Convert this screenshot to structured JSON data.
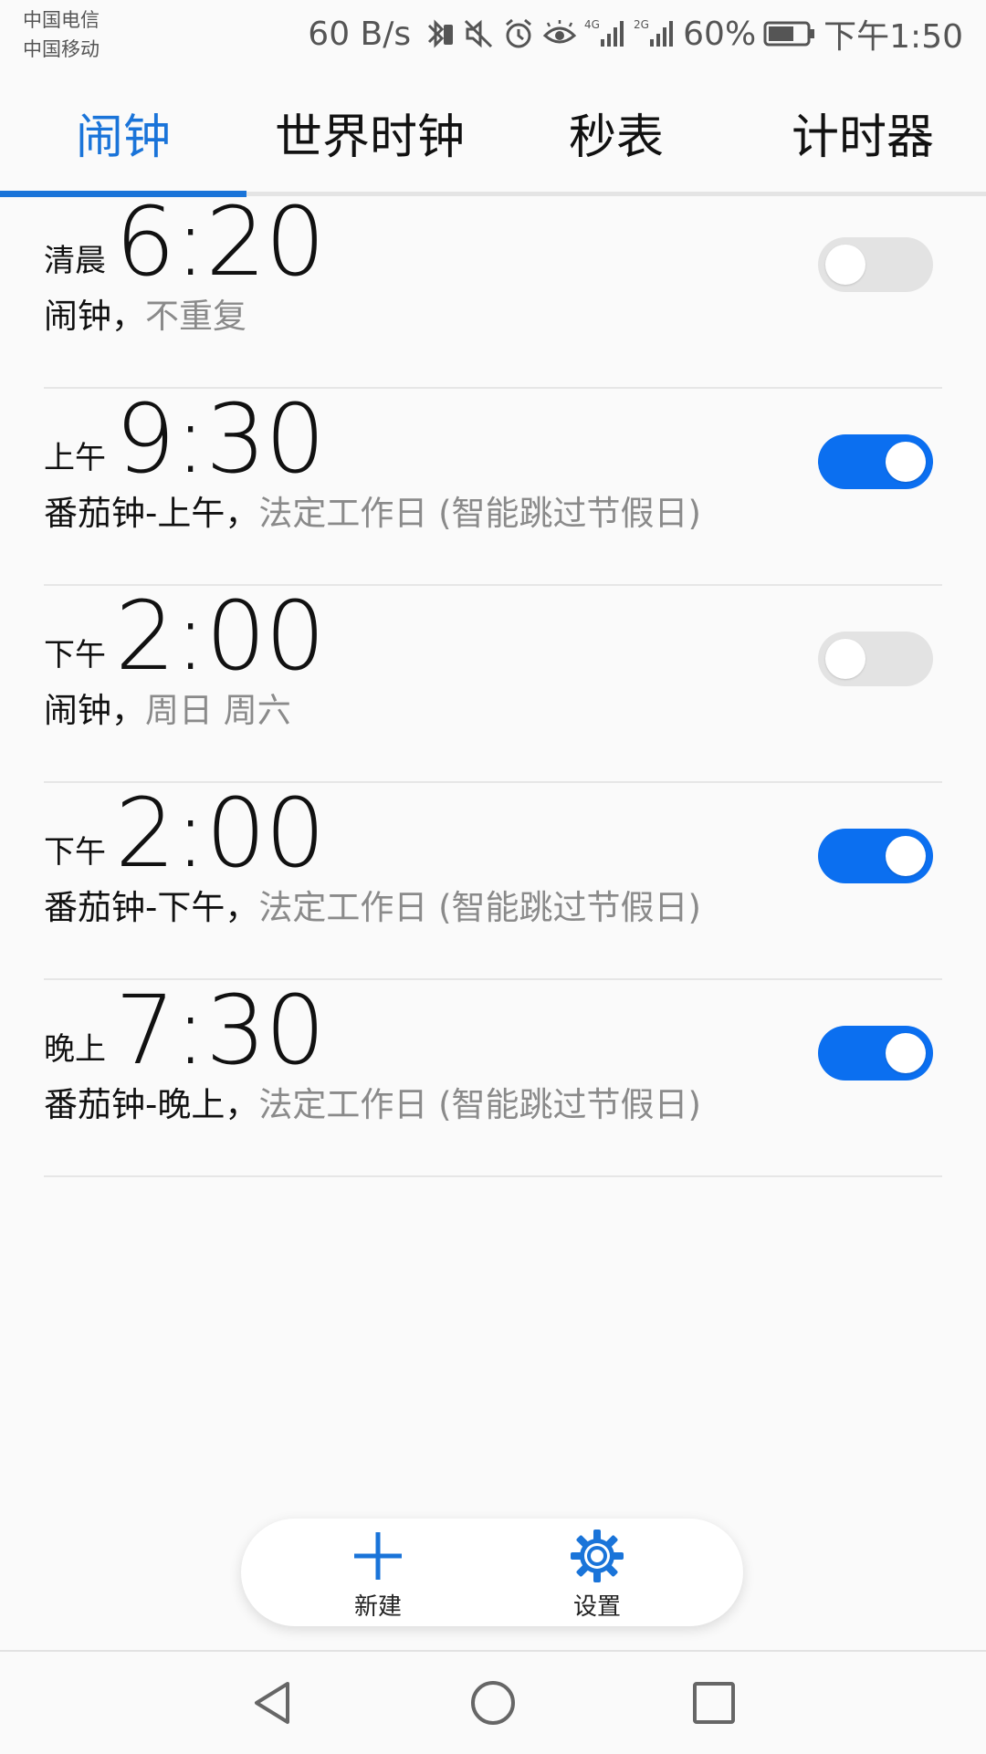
{
  "status_bar": {
    "carrier_1": "中国电信",
    "carrier_2": "中国移动",
    "net_speed": "60 B/s",
    "battery_percent": "60%",
    "clock": "下午1:50"
  },
  "tabs": [
    {
      "label": "闹钟",
      "active": true
    },
    {
      "label": "世界时钟",
      "active": false
    },
    {
      "label": "秒表",
      "active": false
    },
    {
      "label": "计时器",
      "active": false
    }
  ],
  "alarms": [
    {
      "period": "清晨",
      "time": "6:20",
      "name": "闹钟",
      "sep": "，",
      "repeat": "不重复",
      "enabled": false
    },
    {
      "period": "上午",
      "time": "9:30",
      "name": "番茄钟-上午",
      "sep": "，",
      "repeat": "法定工作日 (智能跳过节假日)",
      "enabled": true
    },
    {
      "period": "下午",
      "time": "2:00",
      "name": "闹钟",
      "sep": "，",
      "repeat": "周日 周六",
      "enabled": false
    },
    {
      "period": "下午",
      "time": "2:00",
      "name": "番茄钟-下午",
      "sep": "，",
      "repeat": "法定工作日 (智能跳过节假日)",
      "enabled": true
    },
    {
      "period": "晚上",
      "time": "7:30",
      "name": "番茄钟-晚上",
      "sep": "，",
      "repeat": "法定工作日 (智能跳过节假日)",
      "enabled": true
    }
  ],
  "actions": {
    "new_label": "新建",
    "settings_label": "设置"
  },
  "colors": {
    "accent": "#1a74d9",
    "toggle_on": "#0b6ff0",
    "toggle_off": "#e3e3e3"
  }
}
